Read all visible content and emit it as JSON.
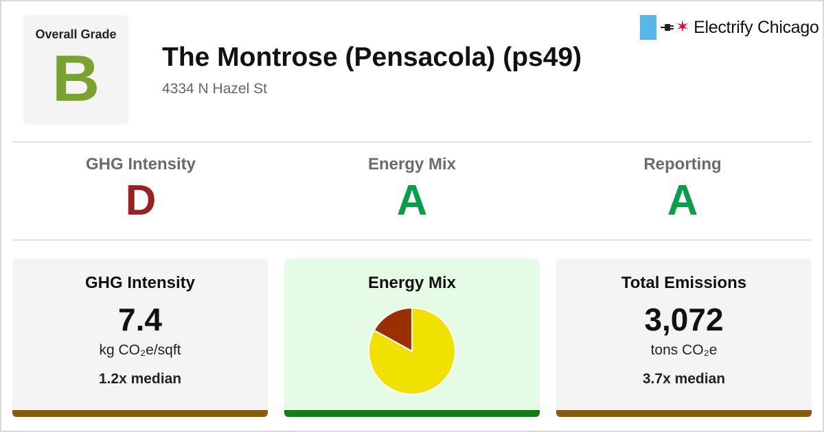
{
  "overall": {
    "label": "Overall Grade",
    "grade": "B",
    "color": "#7aa22f"
  },
  "building": {
    "name": "The Montrose (Pensacola) (ps49)",
    "address": "4334 N Hazel St"
  },
  "logo": {
    "text": "Electrify Chicago",
    "icon": "chicago-flag-plug-star-icon"
  },
  "grades": [
    {
      "label": "GHG Intensity",
      "grade": "D",
      "color": "#9b2020"
    },
    {
      "label": "Energy Mix",
      "grade": "A",
      "color": "#0a9e4c"
    },
    {
      "label": "Reporting",
      "grade": "A",
      "color": "#0a9e4c"
    }
  ],
  "cards": {
    "ghg": {
      "title": "GHG Intensity",
      "value": "7.4",
      "unit": "kg CO₂e/sqft",
      "median": "1.2x median",
      "bar_color": "#8a5a0b"
    },
    "mix": {
      "title": "Energy Mix",
      "bg_color": "#e6fbe6",
      "bar_color": "#0f7f0f"
    },
    "emissions": {
      "title": "Total Emissions",
      "value": "3,072",
      "unit": "tons CO₂e",
      "median": "3.7x median",
      "bar_color": "#8a5a0b"
    }
  },
  "chart_data": {
    "type": "pie",
    "slices": [
      {
        "value": 83,
        "color": "#f0e100"
      },
      {
        "value": 17,
        "color": "#9a3000"
      }
    ]
  }
}
